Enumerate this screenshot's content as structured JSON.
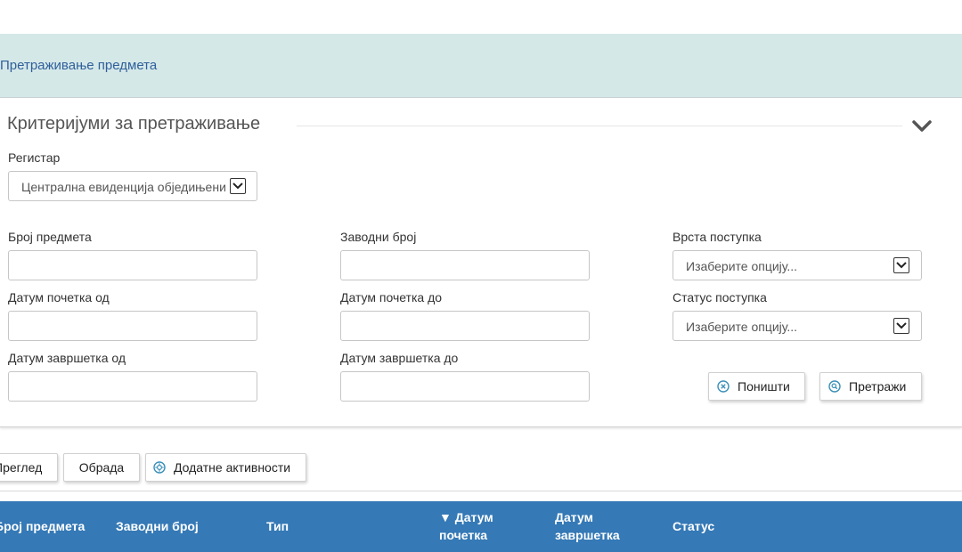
{
  "header": {
    "title": "Претраживање предмета"
  },
  "criteria": {
    "title": "Критеријуми за претраживање",
    "registry": {
      "label": "Регистар",
      "value": "Централна евиденција обједињени"
    },
    "case_number": {
      "label": "Број предмета",
      "value": ""
    },
    "filing_number": {
      "label": "Заводни број",
      "value": ""
    },
    "procedure_type": {
      "label": "Врста поступка",
      "value": "Изаберите опцију..."
    },
    "start_date_from": {
      "label": "Датум почетка од",
      "value": ""
    },
    "start_date_to": {
      "label": "Датум почетка до",
      "value": ""
    },
    "procedure_status": {
      "label": "Статус поступка",
      "value": "Изаберите опцију..."
    },
    "end_date_from": {
      "label": "Датум завршетка од",
      "value": ""
    },
    "end_date_to": {
      "label": "Датум завршетка до",
      "value": ""
    },
    "reset_label": "Поништи",
    "search_label": "Претражи"
  },
  "actions": {
    "preview_label": "Преглед",
    "process_label": "Обрада",
    "additional_label": "Додатне активности"
  },
  "table": {
    "columns": [
      {
        "line1": "Број предмета",
        "line2": ""
      },
      {
        "line1": "Заводни број",
        "line2": ""
      },
      {
        "line1": "Тип",
        "line2": ""
      },
      {
        "line1": "▼ Датум",
        "line2": "почетка"
      },
      {
        "line1": "Датум",
        "line2": "завршетка"
      },
      {
        "line1": "Статус",
        "line2": ""
      }
    ]
  },
  "colors": {
    "header_band": "#d5e8e8",
    "title_link": "#2f5f9b",
    "table_header": "#3579b6",
    "icon_accent": "#3a8fb8"
  },
  "icons": {
    "collapse": "chevron-down-icon",
    "reset": "cancel-circle-icon",
    "search": "search-circle-icon",
    "additional": "settings-circle-icon"
  }
}
